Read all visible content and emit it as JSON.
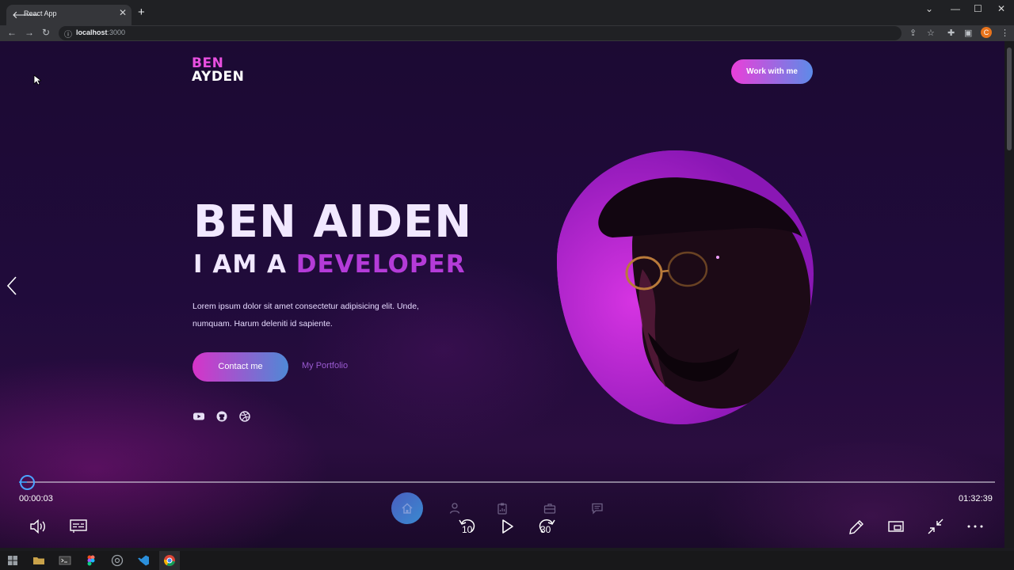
{
  "browser": {
    "tab_title": "React App",
    "url_host": "localhost",
    "url_port": ":3000",
    "profile_initial": "C"
  },
  "site": {
    "logo_line1": "BEN",
    "logo_line2": "AYDEN",
    "work_button": "Work with me",
    "hero_name": "BEN AIDEN",
    "hero_role_prefix": "I AM A ",
    "hero_role_highlight": "DEVELOPER",
    "hero_description": "Lorem ipsum dolor sit amet consectetur adipisicing elit. Unde, numquam. Harum deleniti id sapiente.",
    "contact_button": "Contact me",
    "portfolio_link": "My Portfolio",
    "socials": [
      "youtube-icon",
      "github-icon",
      "dribbble-icon"
    ],
    "dock": [
      "home-icon",
      "user-icon",
      "clipboard-icon",
      "briefcase-icon",
      "message-icon"
    ]
  },
  "player": {
    "elapsed": "00:00:03",
    "duration": "01:32:39",
    "progress": 0.0005,
    "rewind_seconds": "10",
    "forward_seconds": "30"
  },
  "colors": {
    "accent_pink": "#e84fe0",
    "accent_blue": "#5d8be8",
    "highlight_purple": "#b43bd8",
    "seek_blue": "#4ba3ff"
  }
}
